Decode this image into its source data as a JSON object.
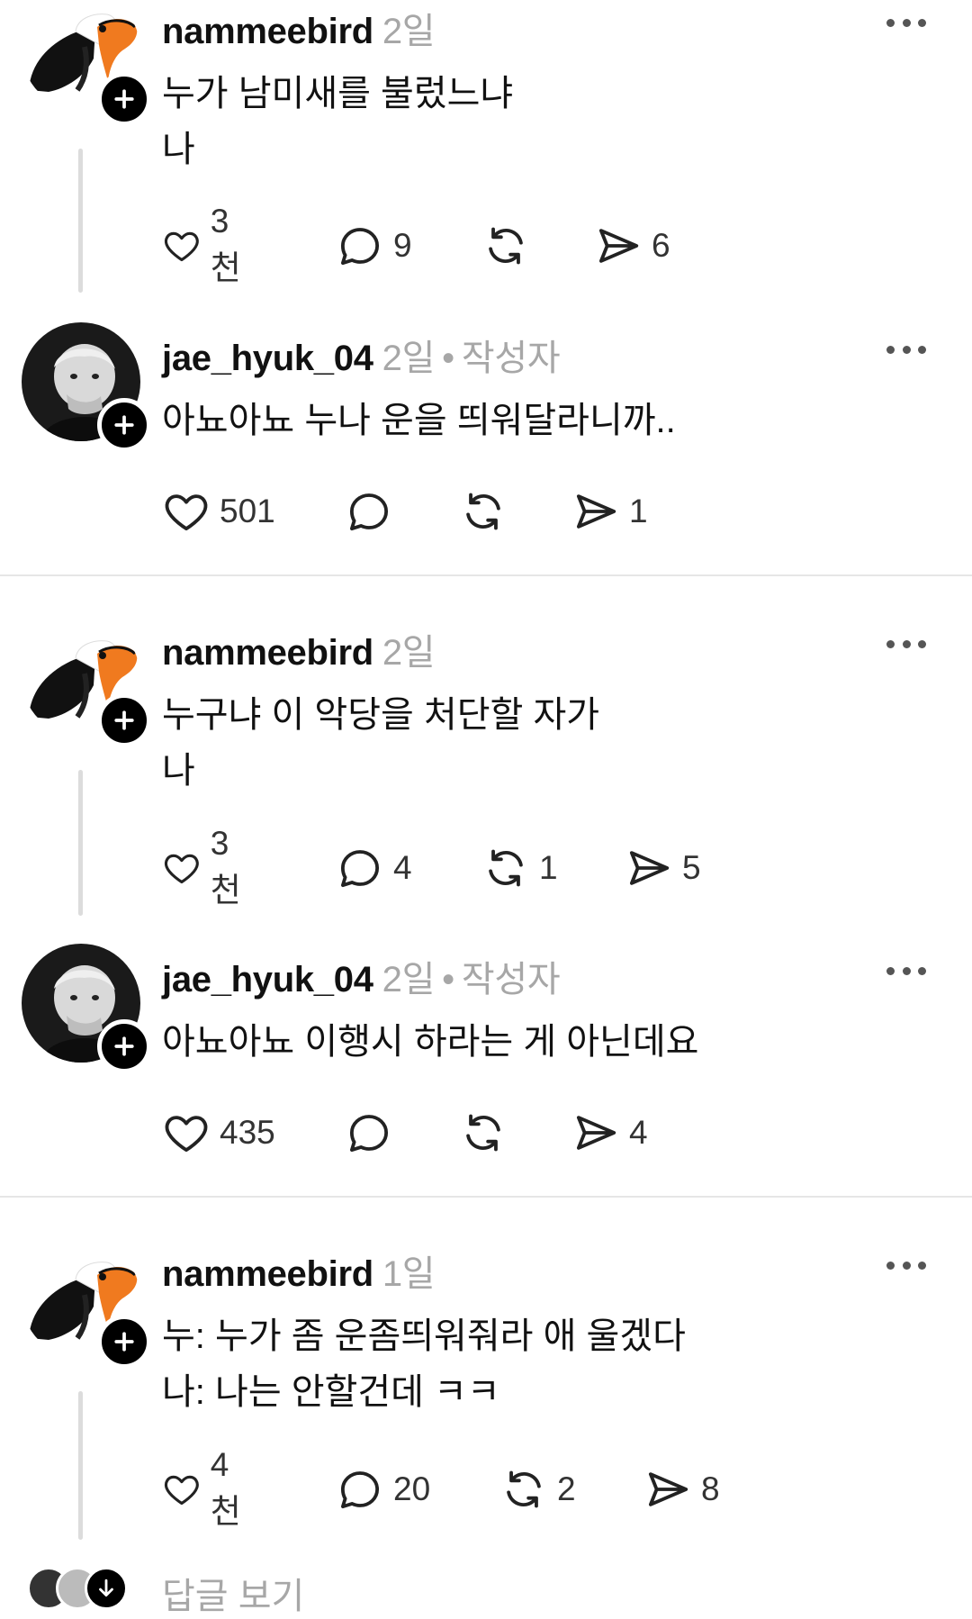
{
  "posts": [
    {
      "username": "nammeebird",
      "time": "2일",
      "author_tag": "",
      "text": "누가 남미새를 불렀느냐\n나",
      "avatar": "toucan",
      "likes": "3천",
      "comments": "9",
      "reposts": "",
      "shares": "6"
    },
    {
      "username": "jae_hyuk_04",
      "time": "2일",
      "author_tag": "작성자",
      "text": "아뇨아뇨 누나 운을 띄워달라니까..",
      "avatar": "person-bw",
      "likes": "501",
      "comments": "",
      "reposts": "",
      "shares": "1"
    },
    {
      "username": "nammeebird",
      "time": "2일",
      "author_tag": "",
      "text": "누구냐 이 악당을 처단할 자가\n나",
      "avatar": "toucan",
      "likes": "3천",
      "comments": "4",
      "reposts": "1",
      "shares": "5"
    },
    {
      "username": "jae_hyuk_04",
      "time": "2일",
      "author_tag": "작성자",
      "text": "아뇨아뇨 이행시 하라는 게 아닌데요",
      "avatar": "person-bw",
      "likes": "435",
      "comments": "",
      "reposts": "",
      "shares": "4"
    },
    {
      "username": "nammeebird",
      "time": "1일",
      "author_tag": "",
      "text": "누: 누가 좀 운좀띄워줘라 애 울겠다\n나: 나는 안할건데 ㅋㅋ",
      "avatar": "toucan",
      "likes": "4천",
      "comments": "20",
      "reposts": "2",
      "shares": "8"
    }
  ],
  "view_replies": {
    "label": "답글 보기"
  },
  "icons": {
    "like": "heart-icon",
    "comment": "comment-bubble-icon",
    "repost": "repost-icon",
    "share": "send-icon",
    "more": "more-icon",
    "follow": "plus-icon"
  },
  "colors": {
    "text": "#111111",
    "muted": "#a7a7a7",
    "divider": "#e6e6e6",
    "toucan_beak": "#f07a1f"
  }
}
